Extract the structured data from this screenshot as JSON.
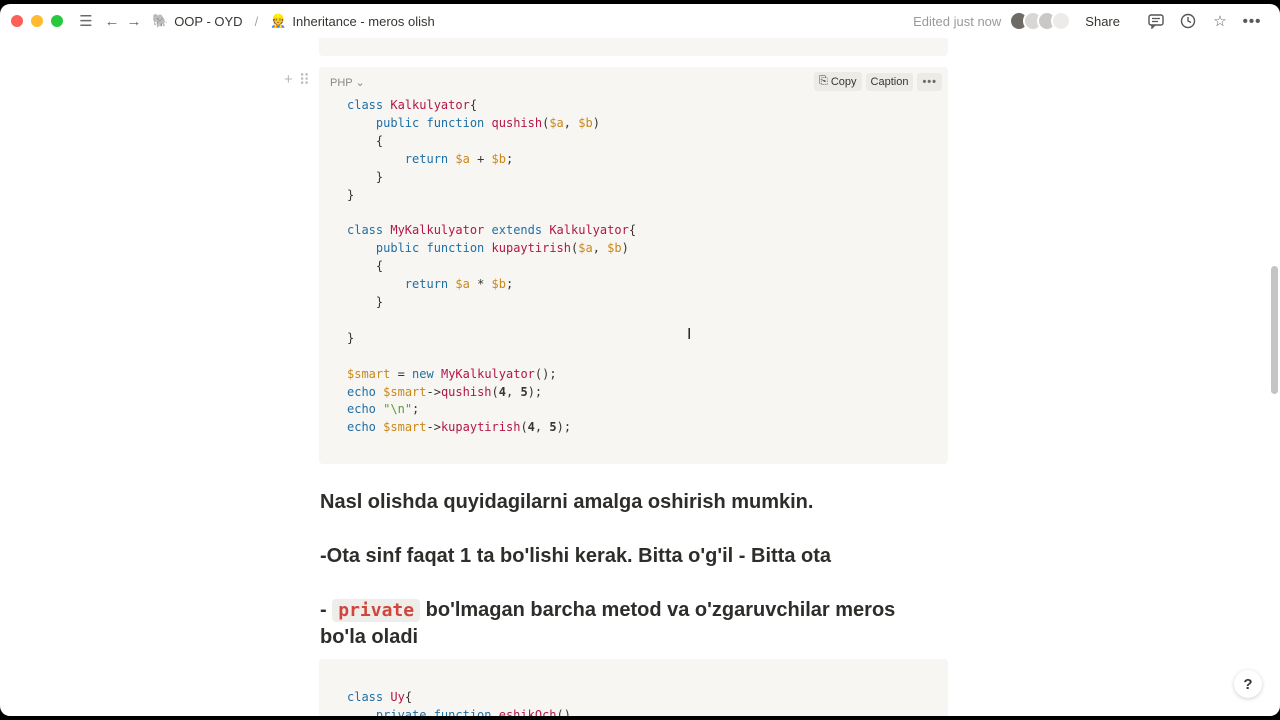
{
  "topbar": {
    "breadcrumb_parent": "OOP - OYD",
    "breadcrumb_separator": "/",
    "breadcrumb_page": "Inheritance - meros olish",
    "edited": "Edited just now",
    "share": "Share",
    "traffic_colors": [
      "#fe5f57",
      "#febc2e",
      "#28c840"
    ]
  },
  "code1": {
    "language": "PHP",
    "copy": "Copy",
    "caption": "Caption",
    "more": "•••"
  },
  "text": {
    "h1": "Nasl olishda quyidagilarni amalga oshirish mumkin.",
    "h2": "-Ota sinf faqat 1 ta bo'lishi kerak. Bitta o'g'il - Bitta ota",
    "h3_prefix": "-",
    "h3_code": "private",
    "h3_rest": " bo'lmagan barcha metod va o'zgaruvchilar meros bo'la oladi"
  },
  "help": "?"
}
